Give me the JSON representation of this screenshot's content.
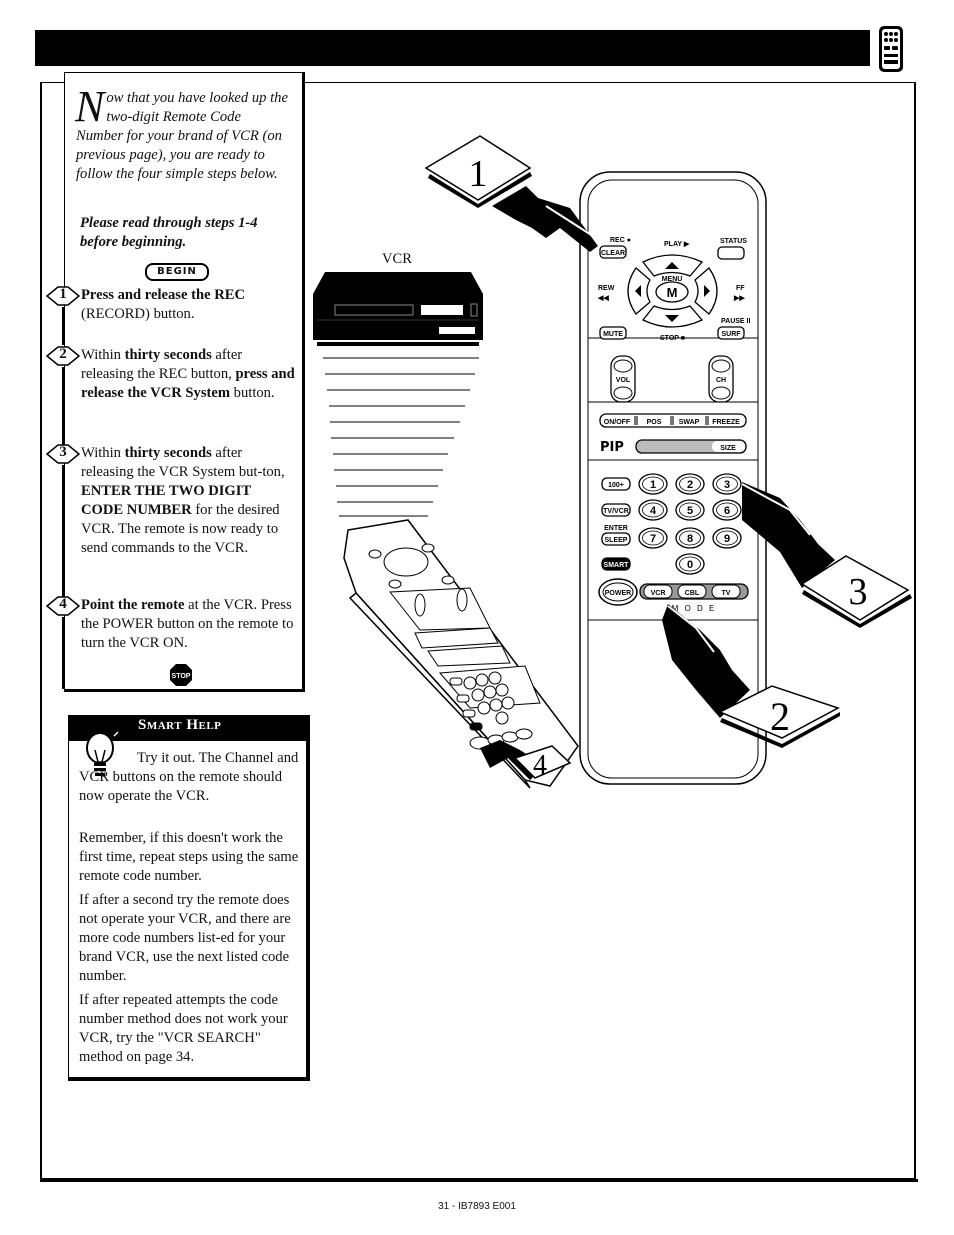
{
  "page": {
    "footer": "31 - IB7893 E001",
    "header_icon": "remote-control-icon"
  },
  "intro": {
    "dropcap": "N",
    "text": "ow that you have looked up the two-digit Remote Code Number for your brand of VCR (on previous page), you are ready to follow the four simple steps below.",
    "note": "Please read through steps 1-4 before beginning.",
    "begin_label": "BEGIN"
  },
  "steps": [
    {
      "number": "1",
      "parts": [
        {
          "bold": true,
          "text": "Press and release the REC"
        },
        {
          "bold": false,
          "text": " (RECORD) button."
        }
      ]
    },
    {
      "number": "2",
      "parts": [
        {
          "bold": false,
          "text": "Within "
        },
        {
          "bold": true,
          "text": "thirty seconds"
        },
        {
          "bold": false,
          "text": " after releasing the REC button, "
        },
        {
          "bold": true,
          "text": "press and release the VCR System"
        },
        {
          "bold": false,
          "text": " button."
        }
      ]
    },
    {
      "number": "3",
      "parts": [
        {
          "bold": false,
          "text": "Within "
        },
        {
          "bold": true,
          "text": "thirty seconds"
        },
        {
          "bold": false,
          "text": " after releasing the VCR System but-ton, "
        },
        {
          "bold": true,
          "text": "ENTER THE TWO DIGIT CODE NUMBER"
        },
        {
          "bold": false,
          "text": " for the desired VCR. The remote is now ready to send commands to the VCR."
        }
      ]
    },
    {
      "number": "4",
      "parts": [
        {
          "bold": true,
          "text": "Point the remote"
        },
        {
          "bold": false,
          "text": " at the VCR. Press the POWER button on the remote to turn the VCR ON."
        }
      ]
    }
  ],
  "stop_label": "STOP",
  "smart_help": {
    "title": "Smart Help",
    "paragraphs": [
      "Try it out. The Channel and VCR buttons on the remote should now operate the VCR.",
      "Remember, if this doesn't work the first time, repeat steps using the same remote code number.",
      "If after a second try the remote does not operate your VCR, and there are more code numbers list-ed for your brand VCR, use the next listed code number.",
      "If after repeated attempts the code number method does not work your VCR, try the \"VCR SEARCH\" method on page 34."
    ]
  },
  "illustration": {
    "vcr_label": "VCR",
    "callouts": [
      "1",
      "2",
      "3",
      "4"
    ],
    "remote": {
      "rec_label": "REC ●",
      "clear_label": "CLEAR",
      "play_label": "PLAY ▶",
      "status_label": "STATUS",
      "menu_label": "MENU",
      "m_label": "M",
      "rew_label": "REW",
      "rew_glyph": "◀◀",
      "ff_label": "FF",
      "ff_glyph": "▶▶",
      "pause_label": "PAUSE II",
      "mute_label": "MUTE",
      "stop_label": "STOP ■",
      "surf_label": "SURF",
      "vol_label": "VOL",
      "ch_label": "CH",
      "pip_buttons": [
        "ON/OFF",
        "POS",
        "SWAP",
        "FREEZE"
      ],
      "pip_label": "PIP",
      "size_label": "SIZE",
      "side_buttons": [
        "100+",
        "TV/VCR",
        "SLEEP",
        "SMART"
      ],
      "enter_label": "ENTER",
      "digits": [
        "1",
        "2",
        "3",
        "4",
        "5",
        "6",
        "7",
        "8",
        "9",
        "0"
      ],
      "power_label": "POWER",
      "mode_buttons": [
        "VCR",
        "CBL",
        "TV"
      ],
      "mode_label": "M O D E"
    }
  }
}
